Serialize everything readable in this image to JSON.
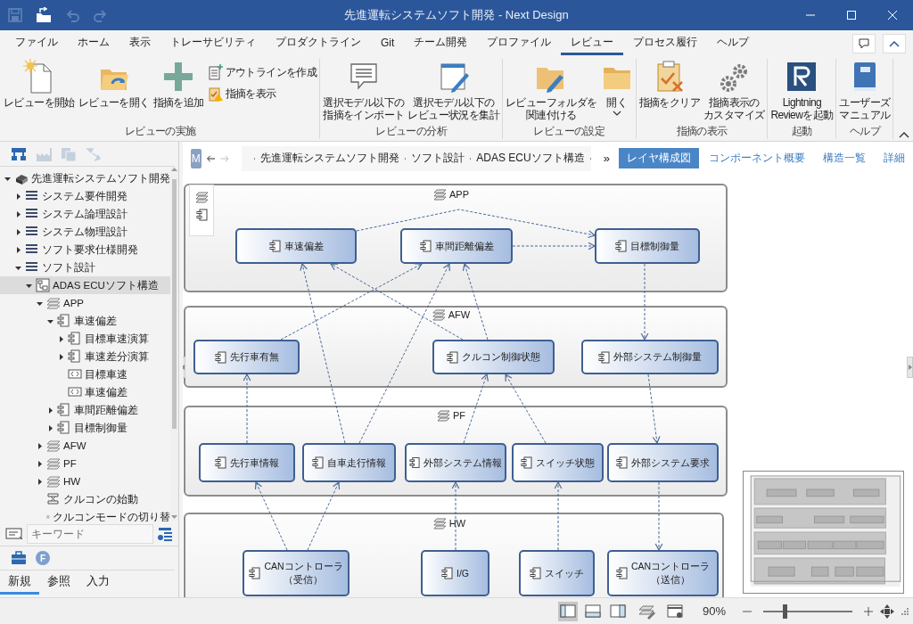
{
  "window": {
    "title": "先進運転システムソフト開発 - Next Design"
  },
  "quick_access": [
    {
      "disabled": true
    },
    {
      "disabled": false
    },
    {
      "disabled": true
    },
    {
      "disabled": true
    }
  ],
  "menu_tabs": [
    {
      "label": "ファイル",
      "selected": false
    },
    {
      "label": "ホーム",
      "selected": false
    },
    {
      "label": "表示",
      "selected": false
    },
    {
      "label": "トレーサビリティ",
      "selected": false
    },
    {
      "label": "プロダクトライン",
      "selected": false
    },
    {
      "label": "Git",
      "selected": false
    },
    {
      "label": "チーム開発",
      "selected": false
    },
    {
      "label": "プロファイル",
      "selected": false
    },
    {
      "label": "レビュー",
      "selected": true
    },
    {
      "label": "プロセス履行",
      "selected": false
    },
    {
      "label": "ヘルプ",
      "selected": false
    }
  ],
  "ribbon": {
    "groups": [
      {
        "label": "レビューの実施",
        "buttons": [
          {
            "kind": "large",
            "label": "レビューを開始"
          },
          {
            "kind": "large",
            "label": "レビューを開く"
          },
          {
            "kind": "large",
            "label": "指摘を追加"
          },
          {
            "kind": "small",
            "label": "アウトラインを作成"
          },
          {
            "kind": "small",
            "label": "指摘を表示"
          }
        ]
      },
      {
        "label": "レビューの分析",
        "buttons": [
          {
            "kind": "large",
            "lines": [
              "選択モデル以下の",
              "指摘をインポート"
            ]
          },
          {
            "kind": "large",
            "lines": [
              "選択モデル以下の",
              "レビュー状況を集計"
            ]
          }
        ]
      },
      {
        "label": "レビューの設定",
        "buttons": [
          {
            "kind": "large",
            "lines": [
              "レビューフォルダを",
              "関連付ける"
            ]
          },
          {
            "kind": "dropdown",
            "label": "開く"
          }
        ]
      },
      {
        "label": "指摘の表示",
        "buttons": [
          {
            "kind": "large",
            "label": "指摘をクリア"
          },
          {
            "kind": "large",
            "lines": [
              "指摘表示の",
              "カスタマイズ"
            ]
          }
        ]
      },
      {
        "label": "起動",
        "buttons": [
          {
            "kind": "large",
            "lines": [
              "Lightning",
              "Reviewを起動"
            ]
          }
        ]
      },
      {
        "label": "ヘルプ",
        "buttons": [
          {
            "kind": "large",
            "lines": [
              "ユーザーズ",
              "マニュアル"
            ]
          }
        ]
      }
    ]
  },
  "sidebar_tools": [
    {
      "disabled": false
    },
    {
      "disabled": true
    },
    {
      "disabled": true
    },
    {
      "disabled": true
    }
  ],
  "tree": [
    {
      "label": "先進運転システムソフト開発",
      "kind": "project",
      "expanded": true,
      "selected": false,
      "children": [
        {
          "label": "システム要件開発",
          "kind": "folder",
          "expanded": false,
          "selected": false
        },
        {
          "label": "システム論理設計",
          "kind": "folder",
          "expanded": false,
          "selected": false
        },
        {
          "label": "システム物理設計",
          "kind": "folder",
          "expanded": false,
          "selected": false
        },
        {
          "label": "ソフト要求仕様開発",
          "kind": "folder",
          "expanded": false,
          "selected": false
        },
        {
          "label": "ソフト設計",
          "kind": "folder",
          "expanded": true,
          "selected": false,
          "children": [
            {
              "label": "ADAS ECUソフト構造",
              "kind": "structure",
              "expanded": true,
              "selected": true,
              "children": [
                {
                  "label": "APP",
                  "kind": "layer",
                  "expanded": true,
                  "selected": false,
                  "children": [
                    {
                      "label": "車速偏差",
                      "kind": "component",
                      "expanded": true,
                      "selected": false,
                      "children": [
                        {
                          "label": "目標車速演算",
                          "kind": "component",
                          "expanded": false,
                          "selected": false
                        },
                        {
                          "label": "車速差分演算",
                          "kind": "component",
                          "expanded": false,
                          "selected": false
                        },
                        {
                          "label": "目標車速",
                          "kind": "port",
                          "selected": false
                        },
                        {
                          "label": "車速偏差",
                          "kind": "port",
                          "selected": false
                        }
                      ]
                    },
                    {
                      "label": "車間距離偏差",
                      "kind": "component",
                      "expanded": false,
                      "selected": false
                    },
                    {
                      "label": "目標制御量",
                      "kind": "component",
                      "expanded": false,
                      "selected": false
                    }
                  ]
                },
                {
                  "label": "AFW",
                  "kind": "layer",
                  "expanded": false,
                  "selected": false
                },
                {
                  "label": "PF",
                  "kind": "layer",
                  "expanded": false,
                  "selected": false
                },
                {
                  "label": "HW",
                  "kind": "layer",
                  "expanded": false,
                  "selected": false
                },
                {
                  "label": "クルコンの始動",
                  "kind": "usecase",
                  "selected": false
                },
                {
                  "label": "クルコンモードの切り替",
                  "kind": "usecase",
                  "selected": false
                }
              ]
            }
          ]
        }
      ]
    }
  ],
  "search": {
    "placeholder": "キーワード"
  },
  "toolbox": {
    "badge": "F"
  },
  "panel_tabs": [
    {
      "label": "新規",
      "selected": true
    },
    {
      "label": "参照",
      "selected": false
    },
    {
      "label": "入力",
      "selected": false
    }
  ],
  "breadcrumb": {
    "badge": "M",
    "back_disabled": false,
    "forward_disabled": true,
    "items": [
      "先進運転システムソフト開発",
      "ソフト設計",
      "ADAS ECUソフト構造"
    ],
    "overflow": "»"
  },
  "view_tabs": [
    {
      "label": "レイヤ構成図",
      "selected": true
    },
    {
      "label": "コンポーネント概要",
      "selected": false
    },
    {
      "label": "構造一覧",
      "selected": false
    },
    {
      "label": "詳細",
      "selected": false
    }
  ],
  "diagram": {
    "layers": [
      {
        "name": "APP",
        "components": [
          {
            "label": "車速偏差"
          },
          {
            "label": "車間距離偏差"
          },
          {
            "label": "目標制御量"
          }
        ]
      },
      {
        "name": "AFW",
        "components": [
          {
            "label": "先行車有無"
          },
          {
            "label": "クルコン制御状態"
          },
          {
            "label": "外部システム制御量"
          }
        ]
      },
      {
        "name": "PF",
        "components": [
          {
            "label": "先行車情報"
          },
          {
            "label": "自車走行情報"
          },
          {
            "label": "外部システム情報"
          },
          {
            "label": "スイッチ状態"
          },
          {
            "label": "外部システム要求"
          }
        ]
      },
      {
        "name": "HW",
        "components": [
          {
            "lines": [
              "CANコントローラ",
              "（受信）"
            ]
          },
          {
            "label": "I/G"
          },
          {
            "label": "スイッチ"
          },
          {
            "lines": [
              "CANコントローラ",
              "（送信）"
            ]
          }
        ]
      }
    ]
  },
  "status_bar": {
    "view_modes": [
      {
        "selected": true
      },
      {
        "selected": false
      },
      {
        "selected": false
      }
    ],
    "zoom": {
      "reading": "90%",
      "level": 0.23
    }
  }
}
